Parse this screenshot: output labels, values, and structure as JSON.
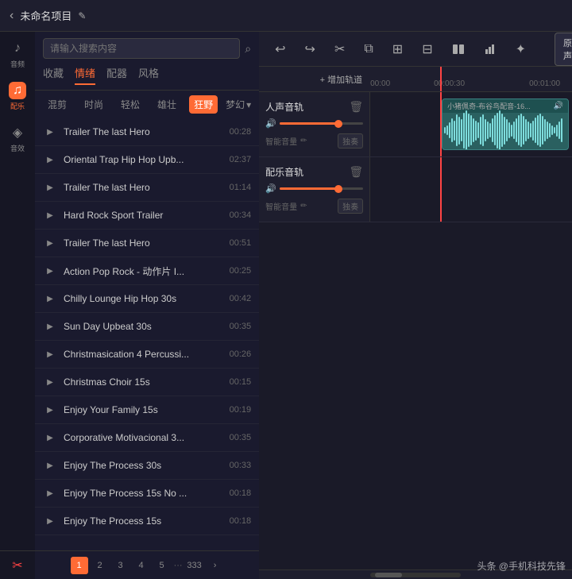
{
  "topbar": {
    "back_label": "‹",
    "title": "未命名项目",
    "edit_icon": "✎"
  },
  "sidebar": {
    "search_placeholder": "请输入搜索内容",
    "search_icon": "⌕",
    "tabs": [
      {
        "label": "收藏",
        "active": false
      },
      {
        "label": "情绪",
        "active": true
      },
      {
        "label": "配器",
        "active": false
      },
      {
        "label": "风格",
        "active": false
      }
    ],
    "sub_tabs": [
      {
        "label": "混剪",
        "active": false
      },
      {
        "label": "时尚",
        "active": false
      },
      {
        "label": "轻松",
        "active": false
      },
      {
        "label": "雄壮",
        "active": false
      },
      {
        "label": "狂野",
        "active": true
      },
      {
        "label": "梦幻",
        "active": false
      }
    ],
    "more_label": "▾",
    "music_list": [
      {
        "name": "Trailer The last Hero",
        "duration": "00:28"
      },
      {
        "name": "Oriental Trap Hip Hop Upb...",
        "duration": "02:37"
      },
      {
        "name": "Trailer The last Hero",
        "duration": "01:14"
      },
      {
        "name": "Hard Rock Sport Trailer",
        "duration": "00:34"
      },
      {
        "name": "Trailer The last Hero",
        "duration": "00:51"
      },
      {
        "name": "Action Pop Rock - 动作片 I...",
        "duration": "00:25"
      },
      {
        "name": "Chilly Lounge Hip Hop 30s",
        "duration": "00:42"
      },
      {
        "name": "Sun Day Upbeat 30s",
        "duration": "00:35"
      },
      {
        "name": "Christmasication 4 Percussi...",
        "duration": "00:26"
      },
      {
        "name": "Christmas Choir 15s",
        "duration": "00:15"
      },
      {
        "name": "Enjoy Your Family 15s",
        "duration": "00:19"
      },
      {
        "name": "Corporative Motivacional 3...",
        "duration": "00:35"
      },
      {
        "name": "Enjoy The Process 30s",
        "duration": "00:33"
      },
      {
        "name": "Enjoy The Process 15s No ...",
        "duration": "00:18"
      },
      {
        "name": "Enjoy The Process 15s",
        "duration": "00:18"
      }
    ],
    "pagination": {
      "current": 1,
      "pages": [
        "1",
        "2",
        "3",
        "4",
        "5",
        "...",
        "333"
      ],
      "next": "›"
    },
    "icons": [
      {
        "label": "音频",
        "icon": "♪",
        "active": false
      },
      {
        "label": "配乐",
        "icon": "♫",
        "active": true
      },
      {
        "label": "音效",
        "icon": "◈",
        "active": false
      }
    ]
  },
  "toolbar": {
    "undo_icon": "↩",
    "redo_icon": "↪",
    "cut_icon": "✂",
    "copy_icon": "⧉",
    "paste_icon": "⊞",
    "delete_icon": "⊟",
    "split_icon": "⫼",
    "chart_icon": "▦",
    "settings_icon": "✦",
    "original_label": "原声"
  },
  "timeline": {
    "add_track_label": "+ 增加轨道",
    "ruler_marks": [
      "00:00",
      "00:00:30",
      "00:01:00"
    ],
    "tracks": [
      {
        "name": "人声音轨",
        "volume_pct": 70,
        "smart_label": "智能音量",
        "solo_label": "独奏",
        "audio_block": {
          "title": "小猪佩奇-布谷鸟配音-16...",
          "volume_icon": "🔊"
        }
      },
      {
        "name": "配乐音轨",
        "volume_pct": 70,
        "smart_label": "智能音量",
        "solo_label": "独奏",
        "audio_block": null
      }
    ]
  },
  "watermark": {
    "text": "头条 @手机科技先锋"
  }
}
